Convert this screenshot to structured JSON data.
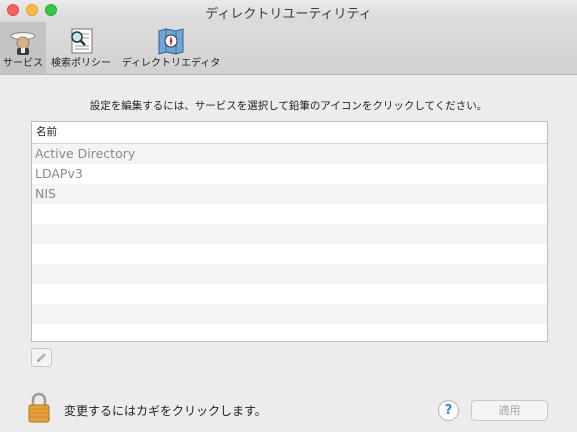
{
  "window": {
    "title": "ディレクトリユーティリティ"
  },
  "toolbar": {
    "items": [
      {
        "label": "サービス",
        "icon": "services-icon",
        "selected": true
      },
      {
        "label": "検索ポリシー",
        "icon": "search-policy-icon",
        "selected": false
      },
      {
        "label": "ディレクトリエディタ",
        "icon": "directory-editor-icon",
        "selected": false
      }
    ]
  },
  "main": {
    "instruction": "設定を編集するには、サービスを選択して鉛筆のアイコンをクリックしてください。",
    "table": {
      "header": "名前",
      "rows": [
        "Active Directory",
        "LDAPv3",
        "NIS"
      ]
    },
    "edit_button_icon": "pencil-icon"
  },
  "footer": {
    "lock_text": "変更するにはカギをクリックします。",
    "help_label": "?",
    "apply_label": "適用"
  },
  "colors": {
    "close": "#fc605b",
    "minimize": "#fdbc40",
    "zoom": "#34c84a",
    "help_accent": "#3b82d9"
  }
}
